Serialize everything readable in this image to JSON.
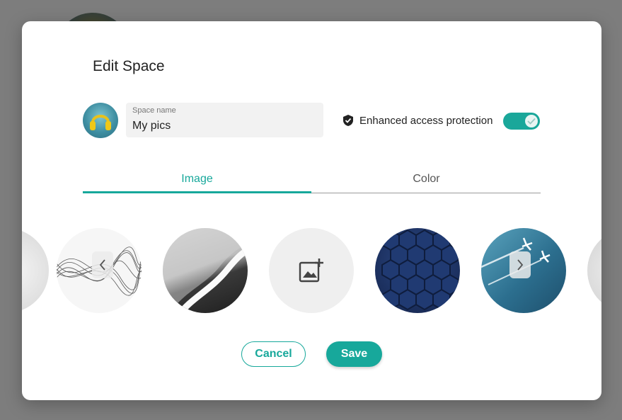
{
  "dialog": {
    "title": "Edit Space",
    "space_name_label": "Space name",
    "space_name_value": "My pics",
    "protection_label": "Enhanced access protection",
    "protection_enabled": true,
    "tabs": [
      {
        "label": "Image",
        "active": true
      },
      {
        "label": "Color",
        "active": false
      }
    ],
    "buttons": {
      "cancel": "Cancel",
      "save": "Save"
    },
    "carousel": {
      "items": [
        "partial-light-image",
        "abstract-waves-image",
        "beach-wave-image",
        "add-image-button",
        "hexagon-pattern-image",
        "airplane-sky-image",
        "partial-light-image-2"
      ],
      "icons": {
        "prev": "chevron-left-icon",
        "next": "chevron-right-icon",
        "add": "add-photo-icon"
      }
    },
    "colors": {
      "accent": "#17a89b",
      "overlay": "#7d7d7d"
    }
  }
}
